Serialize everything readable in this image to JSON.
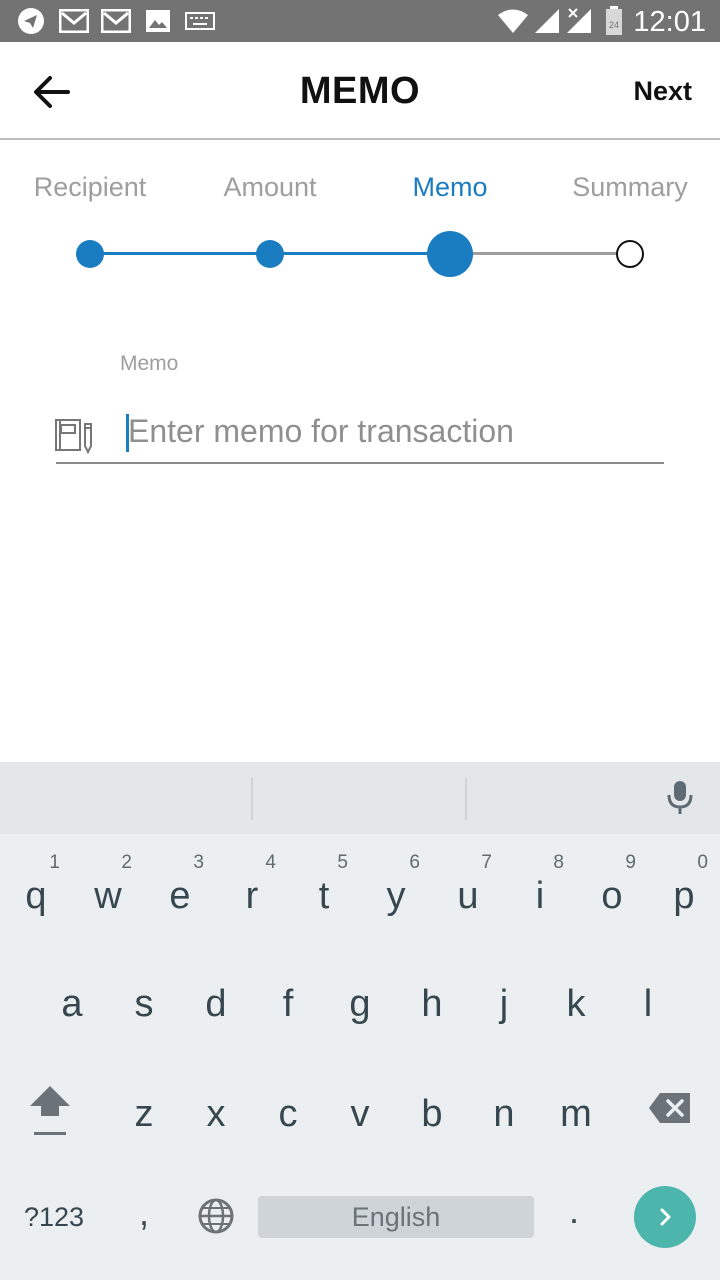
{
  "status_bar": {
    "time": "12:01",
    "icons": [
      "telegram-icon",
      "gmail-icon",
      "gmail-icon",
      "image-icon",
      "keyboard-icon",
      "wifi-icon",
      "signal-icon",
      "signal-icon",
      "battery-icon"
    ],
    "battery_text": "24"
  },
  "app_bar": {
    "title": "MEMO",
    "next_label": "Next",
    "back_icon": "arrow-left-icon"
  },
  "stepper": {
    "steps": [
      {
        "label": "Recipient",
        "state": "done"
      },
      {
        "label": "Amount",
        "state": "done"
      },
      {
        "label": "Memo",
        "state": "current"
      },
      {
        "label": "Summary",
        "state": "pending"
      }
    ],
    "active_color": "#1a7cc1",
    "inactive_color": "#9e9e9e"
  },
  "memo_field": {
    "label": "Memo",
    "placeholder": "Enter memo for transaction",
    "value": "",
    "icon": "notebook-pencil-icon"
  },
  "keyboard": {
    "row1": [
      {
        "ch": "q",
        "hint": "1"
      },
      {
        "ch": "w",
        "hint": "2"
      },
      {
        "ch": "e",
        "hint": "3"
      },
      {
        "ch": "r",
        "hint": "4"
      },
      {
        "ch": "t",
        "hint": "5"
      },
      {
        "ch": "y",
        "hint": "6"
      },
      {
        "ch": "u",
        "hint": "7"
      },
      {
        "ch": "i",
        "hint": "8"
      },
      {
        "ch": "o",
        "hint": "9"
      },
      {
        "ch": "p",
        "hint": "0"
      }
    ],
    "row2": [
      "a",
      "s",
      "d",
      "f",
      "g",
      "h",
      "j",
      "k",
      "l"
    ],
    "row3": [
      "z",
      "x",
      "c",
      "v",
      "b",
      "n",
      "m"
    ],
    "symbols_label": "?123",
    "comma": ",",
    "period": ".",
    "space_label": "English",
    "enter_color": "#4db6ac"
  }
}
